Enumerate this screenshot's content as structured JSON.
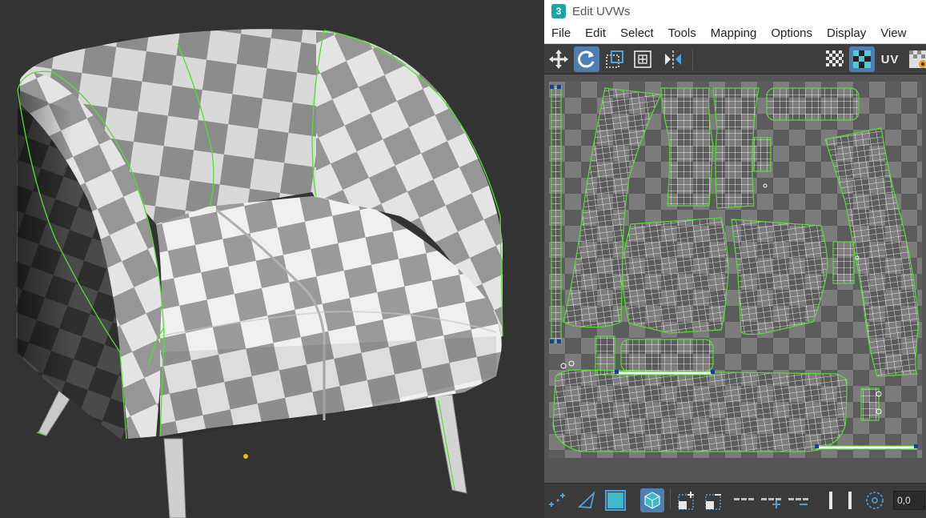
{
  "uv_window": {
    "title": "Edit UVWs",
    "app_icon_glyph": "3",
    "menu": [
      "File",
      "Edit",
      "Select",
      "Tools",
      "Mapping",
      "Options",
      "Display",
      "View"
    ],
    "toolbar": {
      "uv_label": "UV",
      "icons": [
        "move-icon",
        "rotate-icon",
        "freeform-icon",
        "scale-icon",
        "mirror-icon",
        "checker-pattern-icon",
        "checker-texture-icon",
        "settings-icon"
      ]
    },
    "bottombar": {
      "coordinate_value": "0,0",
      "icons": [
        "snap-icon",
        "select-triangle-icon",
        "face-select-icon",
        "element-select-icon",
        "grow-select-icon",
        "shrink-select-icon",
        "loop-select-icon",
        "ring-grow-icon",
        "ring-shrink-icon",
        "soft-selection-icon",
        "pivot-icon"
      ]
    }
  },
  "colors": {
    "seam": "#55dd33",
    "uv_wire": "#ffffff",
    "active_button": "#4f7fb0",
    "viewport_bg": "#333333",
    "checker_light": "#7a7a7a",
    "checker_dark": "#5a5a5a"
  }
}
